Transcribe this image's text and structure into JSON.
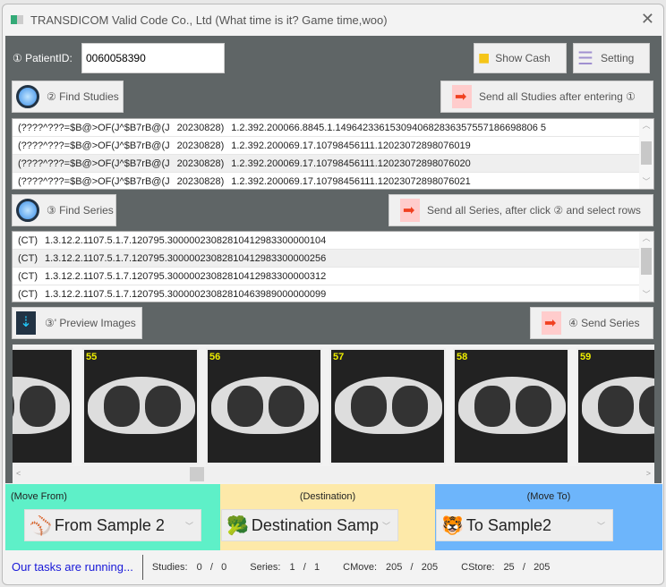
{
  "window": {
    "title": "TRANSDICOM Valid Code Co., Ltd (What time is it? Game time,woo)",
    "close": "✕"
  },
  "patient": {
    "label": "① PatientID:",
    "value": "0060058390"
  },
  "buttons": {
    "show_cash": "Show Cash",
    "setting": "Setting",
    "find_studies": "② Find Studies",
    "send_all_studies": "Send all Studies after entering ①",
    "find_series": "③ Find Series",
    "send_all_series": "Send all Series, after click ② and select rows",
    "preview": "③' Preview Images",
    "send_series": "④ Send Series"
  },
  "studies": [
    {
      "name": "(????^???=$B@>OF(J^$B7rB@(J",
      "date": "20230828)",
      "uid": "1.2.392.200066.8845.1.1496423361530940682836357557186698806 5"
    },
    {
      "name": "(????^???=$B@>OF(J^$B7rB@(J",
      "date": "20230828)",
      "uid": "1.2.392.200069.17.10798456111.12023072898076019"
    },
    {
      "name": "(????^???=$B@>OF(J^$B7rB@(J",
      "date": "20230828)",
      "uid": "1.2.392.200069.17.10798456111.12023072898076020"
    },
    {
      "name": "(????^???=$B@>OF(J^$B7rB@(J",
      "date": "20230828)",
      "uid": "1.2.392.200069.17.10798456111.12023072898076021"
    }
  ],
  "series": [
    {
      "mod": "(CT)",
      "uid": "1.3.12.2.1107.5.1.7.120795.30000023082810412983300000104"
    },
    {
      "mod": "(CT)",
      "uid": "1.3.12.2.1107.5.1.7.120795.30000023082810412983300000256"
    },
    {
      "mod": "(CT)",
      "uid": "1.3.12.2.1107.5.1.7.120795.30000023082810412983300000312"
    },
    {
      "mod": "(CT)",
      "uid": "1.3.12.2.1107.5.1.7.120795.30000023082810463989000000099"
    }
  ],
  "images": [
    "",
    "55",
    "56",
    "57",
    "58",
    "59"
  ],
  "move_from": {
    "label": "(Move From)",
    "value": "From Sample 2",
    "icon": "⚾",
    "color": "#5ef0c8"
  },
  "destination": {
    "label": "(Destination)",
    "value": "Destination Samp",
    "icon": "🥦",
    "color": "#fde9a9"
  },
  "move_to": {
    "label": "(Move To)",
    "value": "To Sample2",
    "icon": "🐯",
    "color": "#6db5fb"
  },
  "status": {
    "running": "Our tasks are running...",
    "studies_label": "Studies:",
    "studies": "0   /   0",
    "series_label": "Series:",
    "series": "1   /   1",
    "cmove_label": "CMove:",
    "cmove": "205   /   205",
    "cstore_label": "CStore:",
    "cstore": "25   /   205"
  }
}
